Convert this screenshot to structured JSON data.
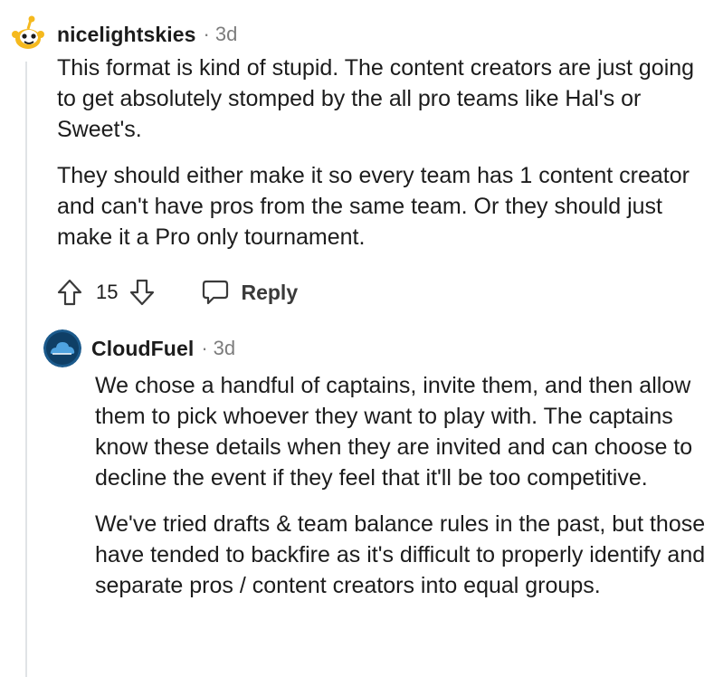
{
  "thread": {
    "comment": {
      "author": "nicelightskies",
      "separator": "·",
      "age": "3d",
      "avatar_icon": "snoo-avatar-icon",
      "paragraphs": [
        "This format is kind of stupid. The content creators are just going to get absolutely stomped by the all pro teams like Hal's or Sweet's.",
        "They should either make it so every team has 1 content creator and can't have pros from the same team. Or they should just make it a Pro only tournament."
      ],
      "score": "15",
      "reply_label": "Reply"
    },
    "reply": {
      "author": "CloudFuel",
      "separator": "·",
      "age": "3d",
      "avatar_icon": "cloud-logo-icon",
      "paragraphs": [
        "We chose a handful of captains, invite them, and then allow them to pick whoever they want to play with. The captains know these details when they are invited and can choose to decline the event if they feel that it'll be too competitive.",
        "We've tried drafts & team balance rules in the past, but those have tended to backfire as it's difficult to properly identify and separate pros / content creators into equal groups."
      ]
    }
  },
  "colors": {
    "text": "#1c1c1c",
    "meta": "#7c7c7c",
    "thread_line": "#e0e3e6",
    "snoo_orange": "#f5a623",
    "cloud_blue": "#1b5a8c"
  }
}
